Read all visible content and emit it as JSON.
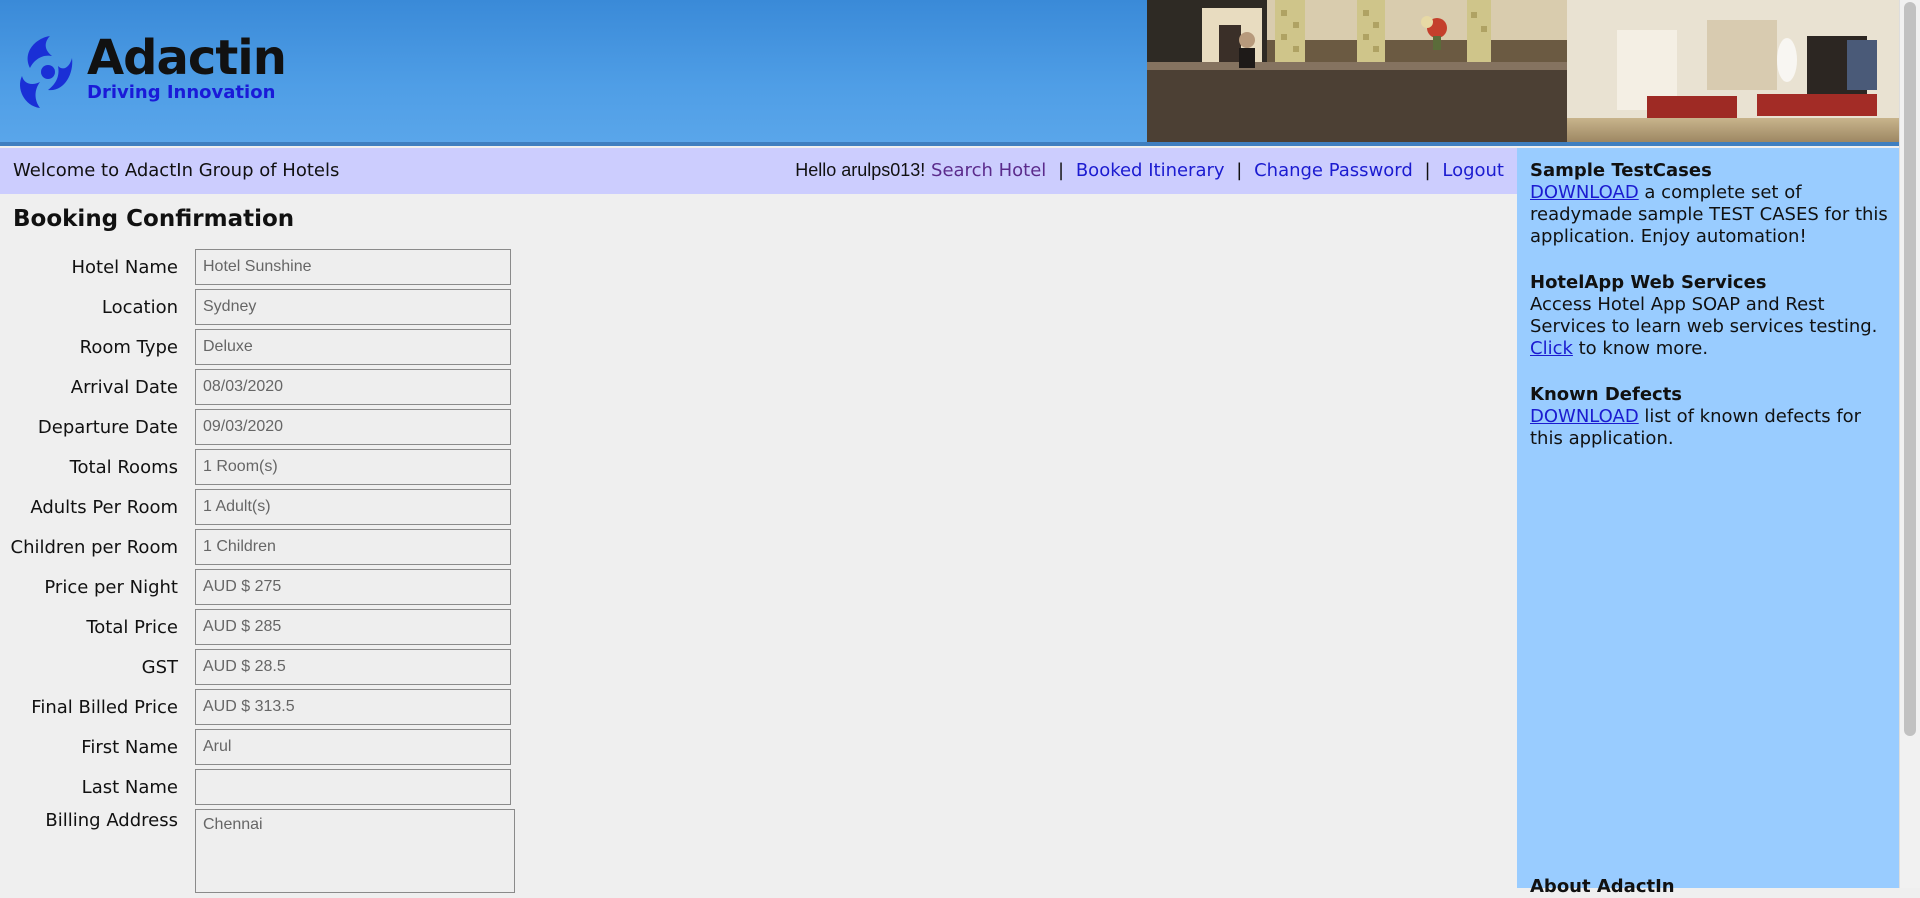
{
  "brand": {
    "name": "Adactin",
    "tagline": "Driving Innovation"
  },
  "welcome": {
    "text": "Welcome to AdactIn Group of Hotels",
    "hello": "Hello arulps013!",
    "links": {
      "search_hotel": "Search Hotel",
      "booked_itinerary": "Booked Itinerary",
      "change_password": "Change Password",
      "logout": "Logout"
    },
    "separator": "|"
  },
  "page": {
    "title": "Booking Confirmation"
  },
  "form": {
    "hotel_name": {
      "label": "Hotel Name",
      "value": "Hotel Sunshine"
    },
    "location": {
      "label": "Location",
      "value": "Sydney"
    },
    "room_type": {
      "label": "Room Type",
      "value": "Deluxe"
    },
    "arrival_date": {
      "label": "Arrival Date",
      "value": "08/03/2020"
    },
    "departure_date": {
      "label": "Departure Date",
      "value": "09/03/2020"
    },
    "total_rooms": {
      "label": "Total Rooms",
      "value": "1 Room(s)"
    },
    "adults_per_room": {
      "label": "Adults Per Room",
      "value": "1 Adult(s)"
    },
    "children_per_room": {
      "label": "Children per Room",
      "value": "1 Children"
    },
    "price_per_night": {
      "label": "Price per Night",
      "value": "AUD $ 275"
    },
    "total_price": {
      "label": "Total Price",
      "value": "AUD $ 285"
    },
    "gst": {
      "label": "GST",
      "value": "AUD $ 28.5"
    },
    "final_billed_price": {
      "label": "Final Billed Price",
      "value": "AUD $ 313.5"
    },
    "first_name": {
      "label": "First Name",
      "value": "Arul"
    },
    "last_name": {
      "label": "Last Name",
      "value": ""
    },
    "billing_address": {
      "label": "Billing Address",
      "value": "Chennai"
    }
  },
  "sidebar": {
    "sample": {
      "heading": "Sample TestCases",
      "link": "DOWNLOAD",
      "text": " a complete set of readymade sample TEST CASES for this application. Enjoy automation!"
    },
    "webservices": {
      "heading": "HotelApp Web Services",
      "text": "Access Hotel App SOAP and Rest Services to learn web services testing.",
      "link": "Click",
      "text2": " to know more."
    },
    "defects": {
      "heading": "Known Defects",
      "link": "DOWNLOAD",
      "text": " list of known defects for this application."
    },
    "about": {
      "heading": "About AdactIn"
    }
  },
  "colors": {
    "header_blue": "#3a8ad8",
    "welcome_bar": "#cccdfe",
    "sidebar_bg": "#99ccff",
    "link": "#1b1bd0",
    "link_visited": "#5b2b8c"
  }
}
